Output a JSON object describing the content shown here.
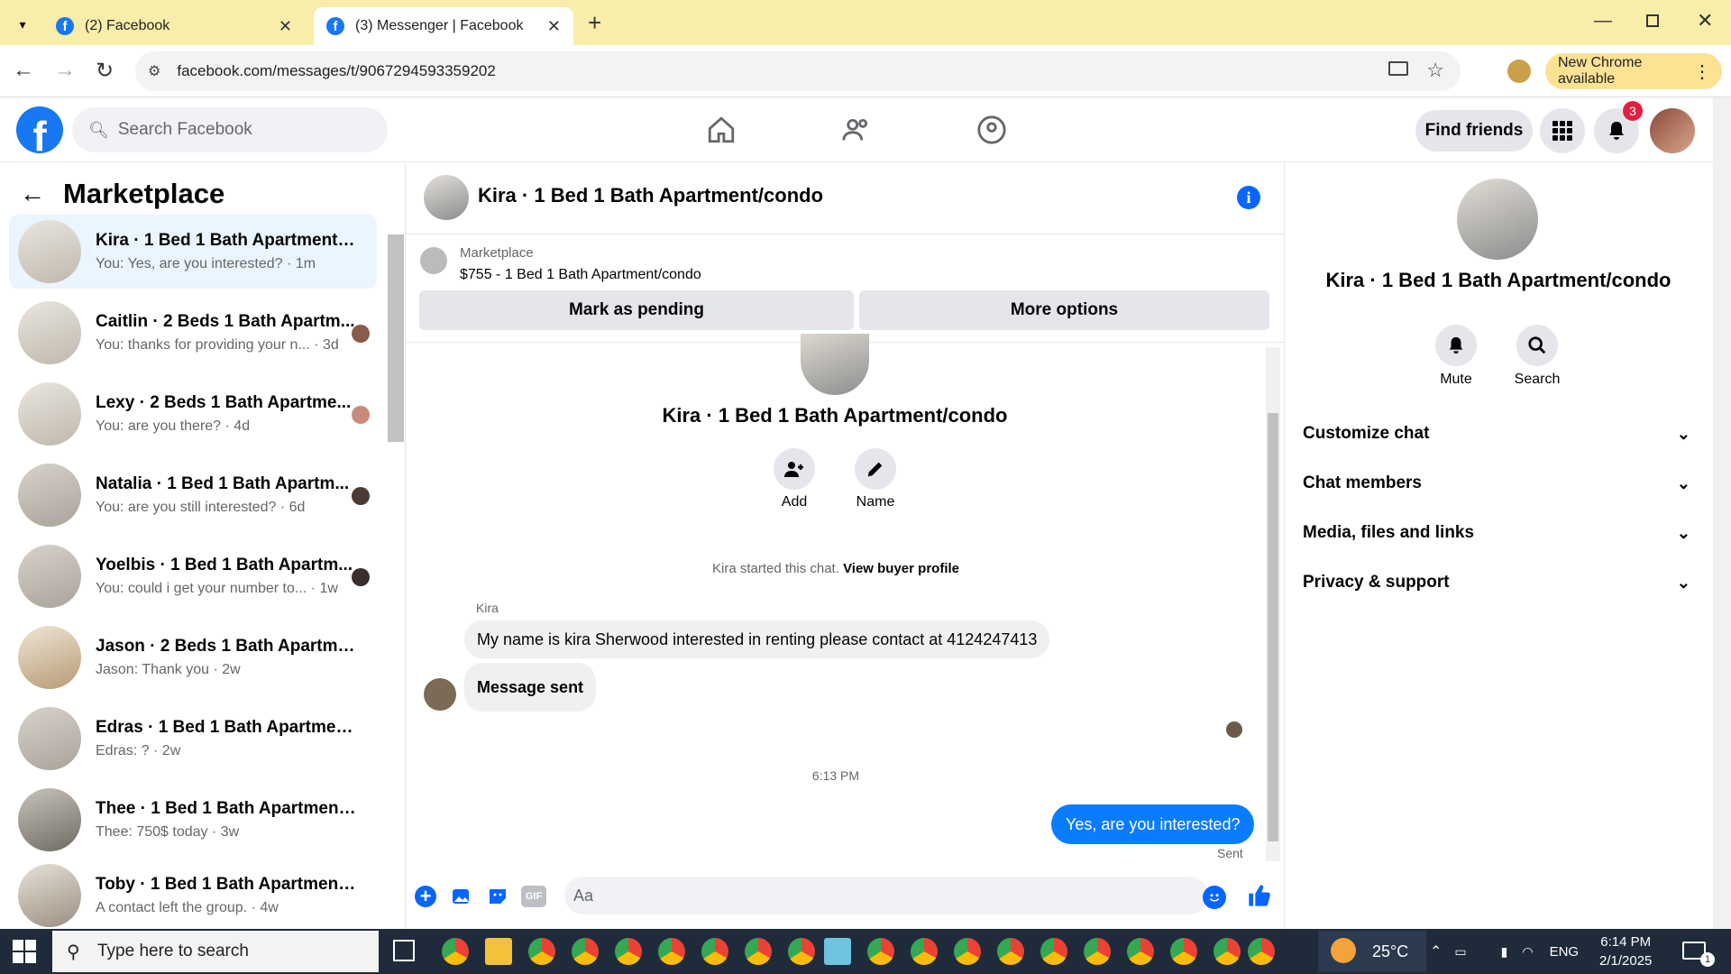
{
  "browser": {
    "tabs": [
      {
        "title": "(2) Facebook"
      },
      {
        "title": "(3) Messenger | Facebook"
      }
    ],
    "url": "facebook.com/messages/t/9067294593359202",
    "update_label": "New Chrome available"
  },
  "fb_header": {
    "search_placeholder": "Search Facebook",
    "find_friends": "Find friends",
    "notification_count": "3"
  },
  "sidebar": {
    "title": "Marketplace",
    "conversations": [
      {
        "name": "Kira · 1 Bed 1 Bath Apartment/c...",
        "preview": "You: Yes, are you interested? · 1m"
      },
      {
        "name": "Caitlin · 2 Beds 1 Bath Apartm...",
        "preview": "You: thanks for providing your n... · 3d"
      },
      {
        "name": "Lexy · 2 Beds 1 Bath Apartme...",
        "preview": "You: are you there? · 4d"
      },
      {
        "name": "Natalia · 1 Bed 1 Bath Apartm...",
        "preview": "You: are you still interested? · 6d"
      },
      {
        "name": "Yoelbis · 1 Bed 1 Bath Apartm...",
        "preview": "You: could i get your number to... · 1w"
      },
      {
        "name": "Jason · 2 Beds 1 Bath Apartment...",
        "preview": "Jason: Thank you · 2w"
      },
      {
        "name": "Edras · 1 Bed 1 Bath Apartment/...",
        "preview": "Edras: ? · 2w"
      },
      {
        "name": "Thee · 1 Bed 1 Bath Apartment/c...",
        "preview": "Thee: 750$ today · 3w"
      },
      {
        "name": "Toby · 1 Bed 1 Bath Apartment/c...",
        "preview": "A contact left the group. · 4w"
      }
    ]
  },
  "chat": {
    "title": "Kira · 1 Bed 1 Bath Apartment/condo",
    "marketplace_label": "Marketplace",
    "listing": "$755 - 1 Bed 1 Bath Apartment/condo",
    "mark_pending": "Mark as pending",
    "more_options": "More options",
    "profile_name": "Kira · 1 Bed 1 Bath Apartment/condo",
    "add_label": "Add",
    "name_label": "Name",
    "started_text": "Kira started this chat.",
    "view_profile": "View buyer profile",
    "sender": "Kira",
    "messages_in": [
      "My name is kira Sherwood interested in renting please contact at 4124247413",
      "Message sent"
    ],
    "timestamp": "6:13 PM",
    "message_out": "Yes, are you interested?",
    "status": "Sent",
    "input_placeholder": "Aa"
  },
  "right_panel": {
    "name": "Kira · 1 Bed 1 Bath Apartment/condo",
    "mute": "Mute",
    "search": "Search",
    "sections": [
      "Customize chat",
      "Chat members",
      "Media, files and links",
      "Privacy & support"
    ]
  },
  "taskbar": {
    "search_placeholder": "Type here to search",
    "temperature": "25°C",
    "language": "ENG",
    "time": "6:14 PM",
    "date": "2/1/2025",
    "notification_count": "1"
  },
  "colors": {
    "fb_blue": "#1877f2",
    "messenger_blue": "#0a7cff",
    "badge_red": "#e41e3f",
    "tab_bar": "#f8eeaa"
  }
}
